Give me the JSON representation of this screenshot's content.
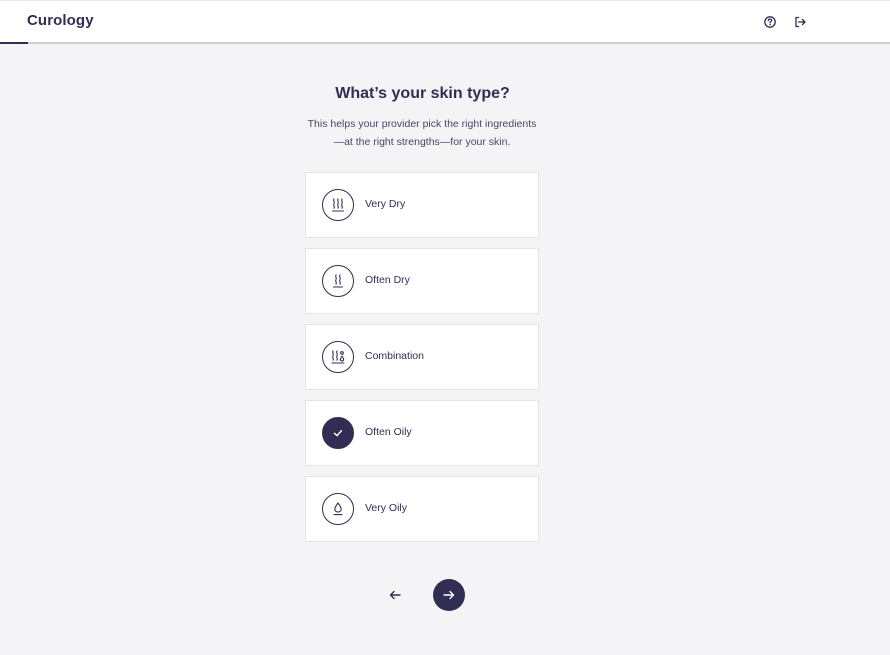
{
  "header": {
    "logo": "Curology",
    "help_icon": "question-circle-icon",
    "logout_icon": "logout-icon"
  },
  "question": {
    "title": "What’s your skin type?",
    "subtitle_line1": "This helps your provider pick the right ingredients",
    "subtitle_line2": "—at the right strengths—for your skin."
  },
  "options": [
    {
      "label": "Very Dry",
      "icon": "heat-waves-three-icon",
      "selected": false
    },
    {
      "label": "Often Dry",
      "icon": "heat-waves-two-icon",
      "selected": false
    },
    {
      "label": "Combination",
      "icon": "combination-icon",
      "selected": false
    },
    {
      "label": "Often Oily",
      "icon": "check-icon",
      "selected": true
    },
    {
      "label": "Very Oily",
      "icon": "droplet-icon",
      "selected": false
    }
  ],
  "navigation": {
    "back_icon": "arrow-left-icon",
    "next_icon": "arrow-right-icon"
  },
  "colors": {
    "primary": "#322d52",
    "background": "#f4f3f6",
    "card": "#ffffff"
  }
}
